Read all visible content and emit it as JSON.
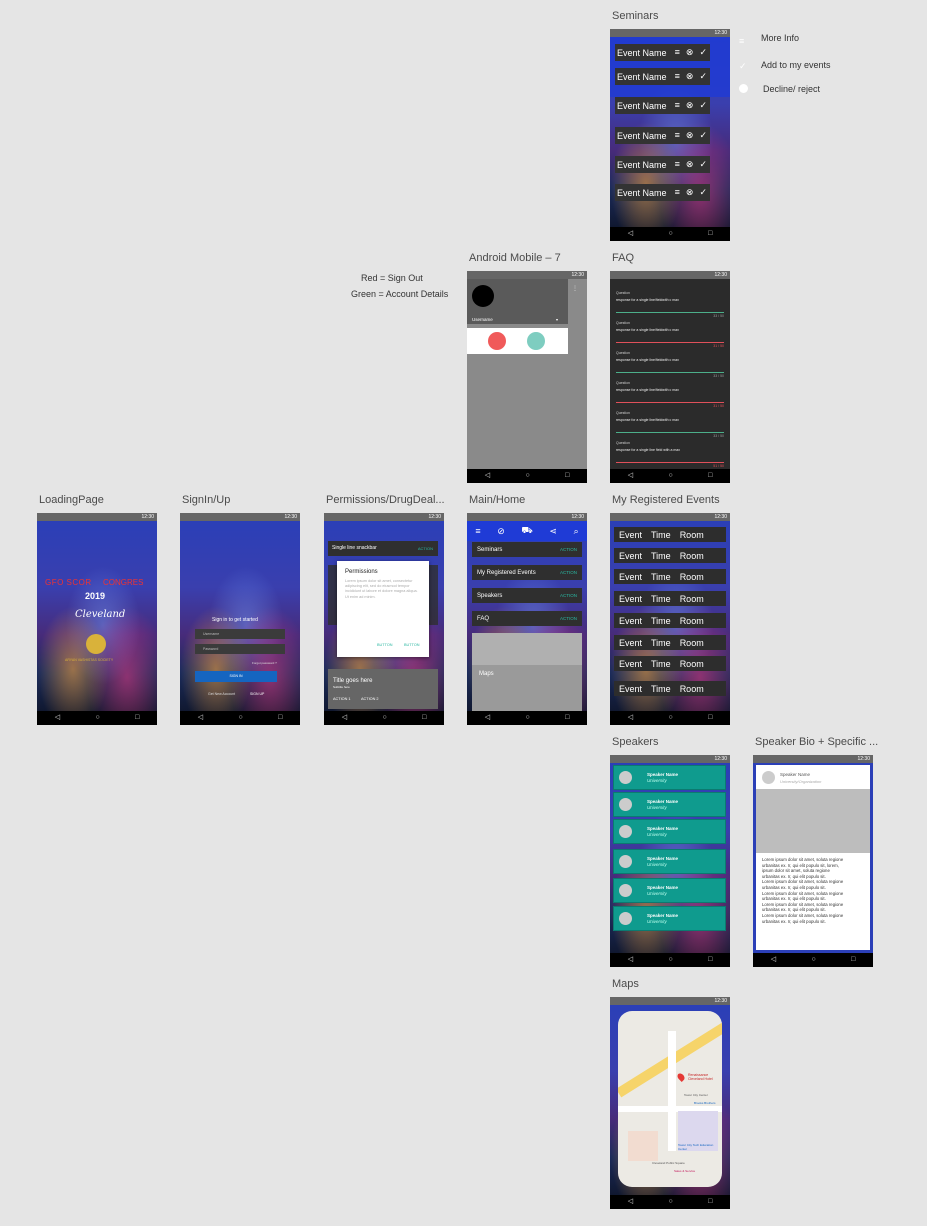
{
  "status_time": "12:30",
  "nav_glyphs": [
    "◁",
    "○",
    "□"
  ],
  "frames": {
    "seminars": "Seminars",
    "android": "Android Mobile – 7",
    "faq": "FAQ",
    "loading": "LoadingPage",
    "signin": "SignIn/Up",
    "permissions": "Permissions/DrugDeal...",
    "main": "Main/Home",
    "registered": "My Registered Events",
    "speakers": "Speakers",
    "speaker_bio": "Speaker Bio + Specific ...",
    "maps": "Maps"
  },
  "notes": {
    "red": "Red = Sign Out",
    "green": "Green = Account Details",
    "colors": {
      "signout": "#f05a5a",
      "account": "#7ecdc0"
    }
  },
  "seminars": {
    "event_label": "Event Name",
    "legend": [
      "More Info",
      "Add to my events",
      "Decline/ reject"
    ],
    "icons": [
      "menu-icon",
      "close-circle-icon",
      "check-icon"
    ]
  },
  "android": {
    "username": "Username"
  },
  "faq": {
    "question": "Question",
    "answer": "response for a single line/fieldwith c max",
    "items": [
      {
        "count": "33 / 50",
        "status": "ok"
      },
      {
        "count": "31 / 50",
        "status": "error"
      },
      {
        "count": "33 / 50",
        "status": "ok"
      },
      {
        "count": "31 / 50",
        "status": "error"
      },
      {
        "count": "33 / 50",
        "status": "ok"
      },
      {
        "count": "51 / 50",
        "status": "error"
      }
    ],
    "last_answer": "response for a single line field with a max"
  },
  "loading": {
    "brand_left": "GFO SCOR",
    "brand_right": "CONGRES",
    "year": "2019",
    "script": "Cleveland",
    "org": "ARYAN VASHISTAS SOCIETY"
  },
  "signin": {
    "heading": "Sign in to get started",
    "username_ph": "Username",
    "password_ph": "Password",
    "forgot": "Forgot password ?",
    "button": "SIGN IN",
    "new_account": "Get New Account",
    "signup": "SIGN UP"
  },
  "permissions": {
    "list_item": "Single line snackbar",
    "action": "ACTION",
    "dialog_title": "Permissions",
    "dialog_body": "Lorem ipsum dolor sit amet, consectetur adipiscing elit, sed do eiusmod tempor incididunt ut labore et dolore magna aliqua. Ut enim ad minim.",
    "btn1": "BUTTON",
    "btn2": "BUTTON",
    "card_title": "Title goes here",
    "card_sub": "Subtitle here",
    "card_a1": "ACTION 1",
    "card_a2": "ACTION 2"
  },
  "main": {
    "items": [
      "Seminars",
      "My Registered Events",
      "Speakers",
      "FAQ"
    ],
    "action": "ACTION",
    "maps": "Maps"
  },
  "registered": {
    "event": "Event",
    "time": "Time",
    "room": "Room"
  },
  "speakers": {
    "name": "Speaker Name",
    "uni": "University"
  },
  "speaker_bio": {
    "name": "Speaker Name",
    "org": "University/Organization",
    "bio_lines": [
      "Lorem ipsum dolor sit amet, soluta regione",
      "urbanitas ex. Ir, qui elit populo sit, lorem,",
      "ipsum dolor sit amet, soluta regione",
      "urbanitas ex. Ir, qui elit populo sit.",
      "Lorem ipsum dolor sit amet, soluta regione",
      "urbanitas ex. Ir, qui elit populo sit.",
      "Lorem ipsum dolor sit amet, soluta regione",
      "urbanitas ex. Ir, qui elit populo sit.",
      "Lorem ipsum dolor sit amet, soluta regione",
      "urbanitas ex. Ir, qui elit populo sit.",
      "Lorem ipsum dolor sit amet, soluta regione",
      "urbanitas ex. Ir, qui elit populo sit."
    ]
  },
  "maps": {
    "place": "Renaissance Cleveland Hotel",
    "labels": [
      "Tower City Center",
      "Brooks Brothers",
      "Tower City Tech Education Center",
      "Cleveland Public Square",
      "Sales & Service"
    ]
  }
}
